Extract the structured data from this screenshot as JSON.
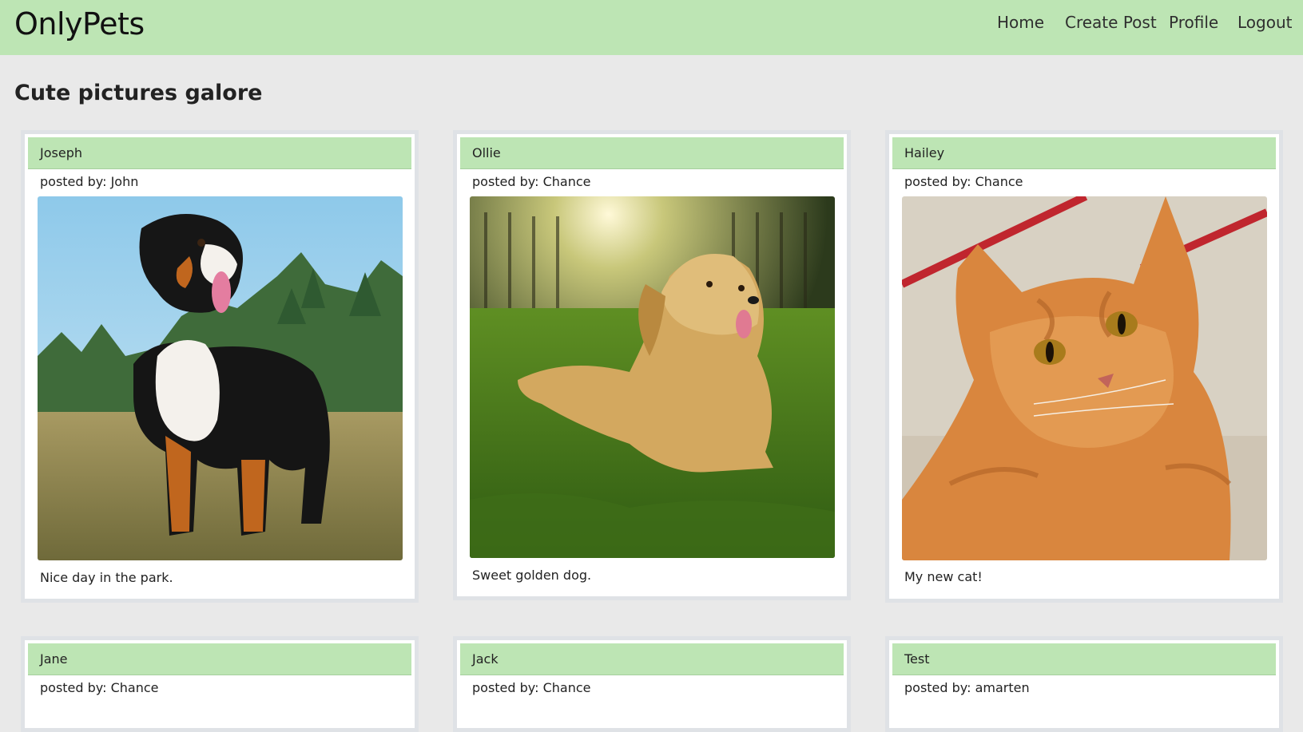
{
  "app": {
    "brand": "OnlyPets"
  },
  "nav": {
    "items": [
      {
        "label": "Home"
      },
      {
        "label": "Create Post"
      },
      {
        "label": "Profile"
      },
      {
        "label": "Logout"
      }
    ]
  },
  "page": {
    "heading": "Cute pictures galore"
  },
  "posts": [
    {
      "title": "Joseph",
      "posted_by": "posted by: John",
      "caption": "Nice day in the park.",
      "image": "bernese-mountain-dog-photo"
    },
    {
      "title": "Ollie",
      "posted_by": "posted by: Chance",
      "caption": "Sweet golden dog.",
      "image": "golden-retriever-photo"
    },
    {
      "title": "Hailey",
      "posted_by": "posted by: Chance",
      "caption": "My new cat!",
      "image": "orange-cat-photo"
    },
    {
      "title": "Jane",
      "posted_by": "posted by: Chance"
    },
    {
      "title": "Jack",
      "posted_by": "posted by: Chance"
    },
    {
      "title": "Test",
      "posted_by": "posted by: amarten"
    }
  ],
  "colors": {
    "navbar": "#bde5b4",
    "card_header": "#bde5b4",
    "page_background": "#e9e9e9",
    "card_border": "#dfe2e6"
  }
}
